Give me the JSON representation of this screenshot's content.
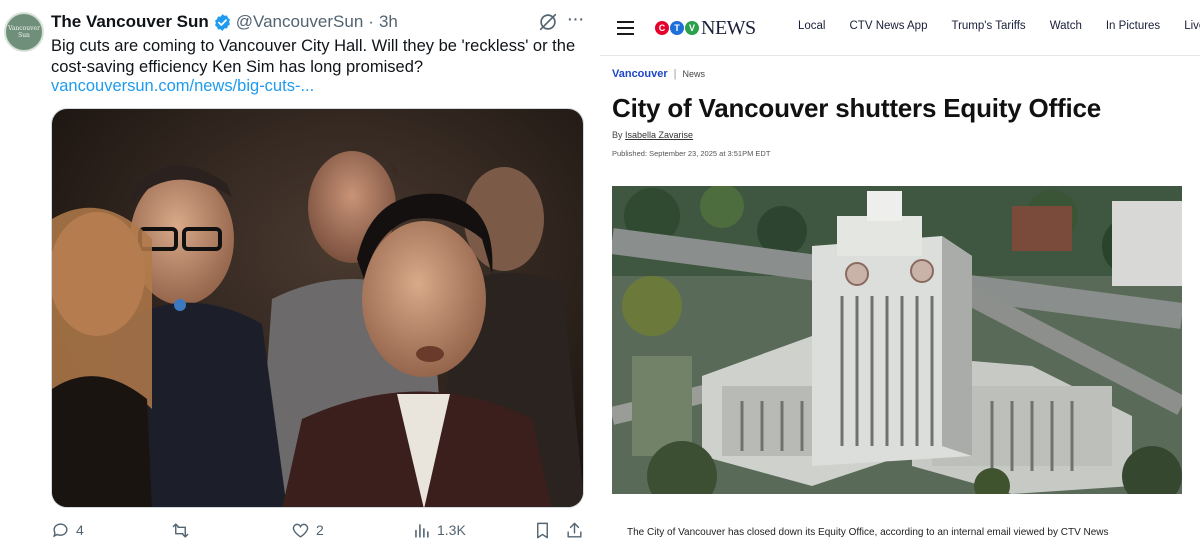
{
  "tweet": {
    "avatar_text": "Vancouver Sun",
    "display_name": "The Vancouver Sun",
    "handle": "@VancouverSun",
    "separator": "·",
    "time": "3h",
    "text": "Big cuts are coming to Vancouver City Hall. Will they be 'reckless' or the cost-saving efficiency Ken Sim has long promised?",
    "link": "vancouversun.com/news/big-cuts-...",
    "actions": {
      "replies": "4",
      "reposts": "",
      "likes": "2",
      "views": "1.3K"
    },
    "icons": [
      "verified-badge-icon",
      "grok-icon",
      "more-icon",
      "reply-icon",
      "repost-icon",
      "like-icon",
      "views-icon",
      "bookmark-icon",
      "share-icon"
    ],
    "colors": {
      "link": "#1d9bf0",
      "verified": "#1d9bf0",
      "muted": "#536471"
    }
  },
  "ctv": {
    "logo": {
      "letters": [
        "C",
        "T",
        "V"
      ],
      "word": "NEWS"
    },
    "nav": [
      "Local",
      "CTV News App",
      "Trump's Tariffs",
      "Watch",
      "In Pictures",
      "Live"
    ],
    "breadcrumb": {
      "section": "Vancouver",
      "separator": "|",
      "type": "News"
    },
    "headline": "City of Vancouver shutters Equity Office",
    "byline_prefix": "By",
    "author": "Isabella Zavarise",
    "published": "Published: September 23, 2025 at 3:51PM EDT",
    "body": "The City of Vancouver has closed down its Equity Office, according to an internal email viewed by CTV News",
    "colors": {
      "section": "#1e46c8",
      "logo_red": "#e4002b",
      "logo_blue": "#1e6fd9",
      "logo_green": "#2aa14a"
    }
  }
}
